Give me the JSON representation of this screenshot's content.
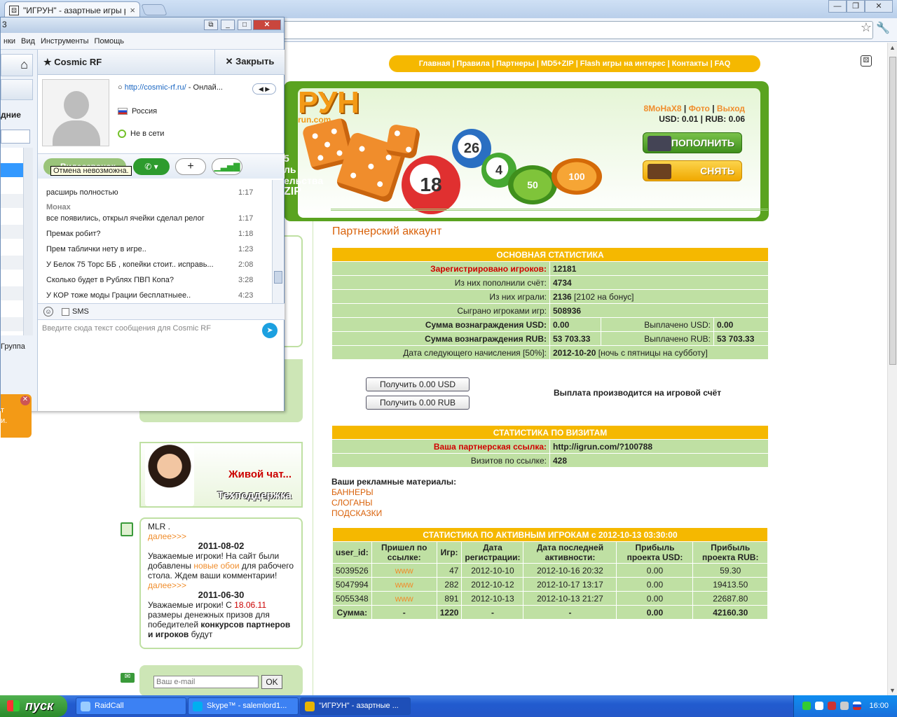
{
  "browser": {
    "tab_title": "\"ИГРУН\" - азартные игры ра",
    "tab_close": "×",
    "minimize": "—",
    "maximize": "❐",
    "close": "✕"
  },
  "site": {
    "nav": [
      "Главная",
      "Правила",
      "Партнеры",
      "MD5+ZIP",
      "Flash игры на интерес",
      "Контакты",
      "FAQ"
    ],
    "logo_text": "РУН",
    "logo_sub": "run.com",
    "banner_side_text": [
      "5",
      "ль",
      "ельства",
      "ZIP"
    ],
    "balls": {
      "b18": "18",
      "b26": "26",
      "b4": "4"
    },
    "chips": {
      "c50": "50",
      "c100": "100",
      "chip_word": "ИГРУН"
    },
    "user": {
      "name": "8МоНаХ8",
      "photo": "Фото",
      "logout": "Выход",
      "balance": "USD: 0.01 | RUB: 0.06"
    },
    "topup_label": "ПОПОЛНИТЬ",
    "withdraw_label": "СНЯТЬ",
    "page_title": "Партнерский аккаунт",
    "main_stats": {
      "header": "ОСНОВНАЯ СТАТИСТИКА",
      "registered_label": "Зарегистрировано игроков:",
      "registered_value": "12181",
      "deposited_label": "Из них пополнили счёт:",
      "deposited_value": "4734",
      "played_label": "Из них играли:",
      "played_value": "2136",
      "played_note": "[2102 на бонус]",
      "games_label": "Сыграно игроками игр:",
      "games_value": "508936",
      "reward_usd_label": "Сумма вознаграждения USD:",
      "reward_usd_value": "0.00",
      "paid_usd_label": "Выплачено USD:",
      "paid_usd_value": "0.00",
      "reward_rub_label": "Сумма вознаграждения RUB:",
      "reward_rub_value": "53 703.33",
      "paid_rub_label": "Выплачено RUB:",
      "paid_rub_value": "53 703.33",
      "next_label": "Дата следующего начисления [50%]:",
      "next_value": "2012-10-20",
      "next_note": "[ночь с пятницы на субботу]"
    },
    "get_usd": "Получить 0.00 USD",
    "get_rub": "Получить 0.00 RUB",
    "payout_note": "Выплата производится на игровой счёт",
    "visit_stats": {
      "header": "СТАТИСТИКА ПО ВИЗИТАМ",
      "link_label": "Ваша партнерская ссылка:",
      "link_value": "http://igrun.com/?100788",
      "visits_label": "Визитов по ссылке:",
      "visits_value": "428"
    },
    "promo": {
      "title": "Ваши рекламные материалы:",
      "banners": "БАННЕРЫ",
      "slogans": "СЛОГАНЫ",
      "hints": "ПОДСКАЗКИ"
    },
    "active": {
      "header": "СТАТИСТИКА ПО АКТИВНЫМ ИГРОКАМ с 2012-10-13 03:30:00",
      "columns": [
        "user_id:",
        "Пришел по ссылке:",
        "Игр:",
        "Дата регистрации:",
        "Дата последней активности:",
        "Прибыль проекта USD:",
        "Прибыль проекта RUB:"
      ],
      "rows": [
        [
          "5039526",
          "www",
          "47",
          "2012-10-10",
          "2012-10-16 20:32",
          "0.00",
          "59.30"
        ],
        [
          "5047994",
          "www",
          "282",
          "2012-10-12",
          "2012-10-17 13:17",
          "0.00",
          "19413.50"
        ],
        [
          "5055348",
          "www",
          "891",
          "2012-10-13",
          "2012-10-13 21:27",
          "0.00",
          "22687.80"
        ]
      ],
      "sum": [
        "Сумма:",
        "-",
        "1220",
        "-",
        "-",
        "0.00",
        "42160.30"
      ]
    },
    "support": {
      "live_chat": "Живой чат...",
      "tech": "Техподдержка"
    },
    "news": {
      "top_text": "MLR .",
      "more1": "далее>>>",
      "date1": "2011-08-02",
      "text1a": "Уважаемые игроки! На сайт были добавлены ",
      "text1b": "новые обои",
      "text1c": " для рабочего стола. Ждем ваши комментарии!",
      "more2": "далее>>>",
      "date2": "2011-06-30",
      "text2a": "Уважаемые игроки! С ",
      "text2b": "18.06.11",
      "text2c": " размеры денежных призов для победителей ",
      "text2d": "конкурсов партнеров и игроков",
      "text2e": " будут"
    },
    "subscribe": {
      "placeholder": "Ваш e-mail",
      "ok": "OK"
    }
  },
  "skype": {
    "title": "3",
    "menu": [
      "нки",
      "Вид",
      "Инструменты",
      "Помощь"
    ],
    "recent": "дние",
    "group": "Группа",
    "orange_text": [
      "т",
      "и."
    ],
    "contact_name": "Cosmic RF",
    "close_label": "Закрыть",
    "mood_link": "http://cosmic-rf.ru/",
    "mood_rest": " - Онлай...",
    "country": "Россия",
    "status": "Не в сети",
    "video_label": "Видеозвонок",
    "tooltip": "Отмена невозможна.",
    "messages": [
      {
        "text": "расширь полностью",
        "time": "1:17"
      },
      {
        "sender": "Монах"
      },
      {
        "text": "все появились, открыл ячейки сделал релог",
        "time": "1:17"
      },
      {
        "text": "Премак робит?",
        "time": "1:18"
      },
      {
        "text": "Прем таблички нету в игре..",
        "time": "1:23"
      },
      {
        "text": "У Белок 75 Торс ББ , копейки стоит.. исправь...",
        "time": "2:08"
      },
      {
        "text": "Сколько будет в Рублях ПВП Копа?",
        "time": "3:28"
      },
      {
        "text": "У КОР тоже моды Грации бесплатныее..",
        "time": "4:23"
      }
    ],
    "sms_label": "SMS",
    "compose_placeholder": "Введите сюда текст сообщения для Cosmic RF"
  },
  "taskbar": {
    "start": "пуск",
    "items": [
      "RaidCall",
      "Skype™ - salemlord1...",
      "\"ИГРУН\" - азартные ..."
    ],
    "clock": "16:00"
  }
}
